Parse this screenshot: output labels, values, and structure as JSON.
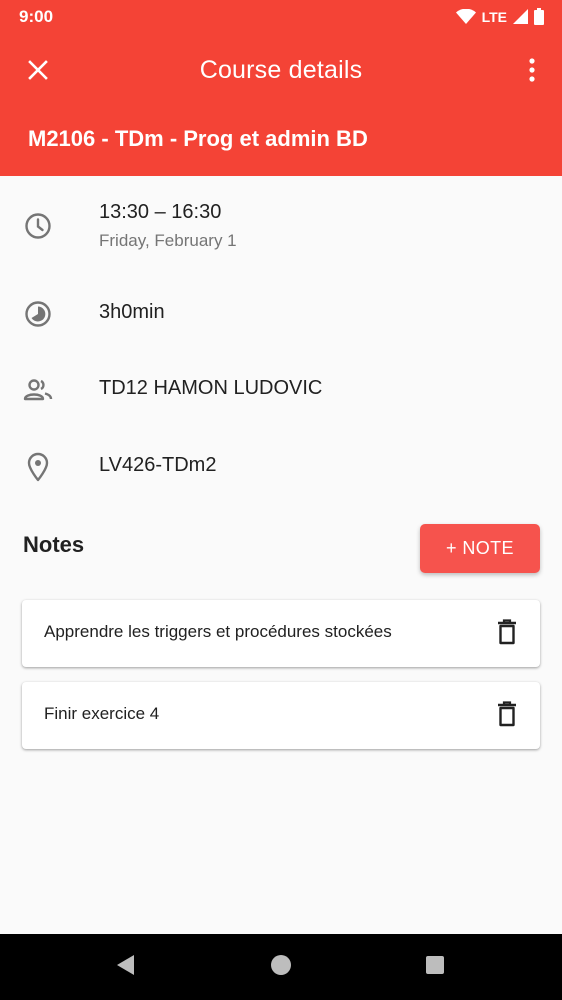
{
  "status_bar": {
    "time": "9:00",
    "network": "LTE"
  },
  "app_bar": {
    "title": "Course details",
    "course_name": "M2106 - TDm - Prog et admin BD"
  },
  "details": {
    "time_range": "13:30  –  16:30",
    "date": "Friday, February 1",
    "duration": "3h0min",
    "group": "TD12 HAMON LUDOVIC",
    "room": "LV426-TDm2"
  },
  "notes": {
    "title": "Notes",
    "add_label": "+ NOTE",
    "items": [
      {
        "text": "Apprendre les triggers et procédures stockées"
      },
      {
        "text": "Finir exercice 4"
      }
    ]
  },
  "icons": {
    "close": "close-icon",
    "menu": "more-vert-icon",
    "time": "clock-icon",
    "duration": "timelapse-icon",
    "group": "people-icon",
    "room": "location-pin-icon",
    "delete": "trash-icon"
  },
  "colors": {
    "primary": "#f44336",
    "accent": "#f6534d",
    "icon_gray": "#757575"
  }
}
